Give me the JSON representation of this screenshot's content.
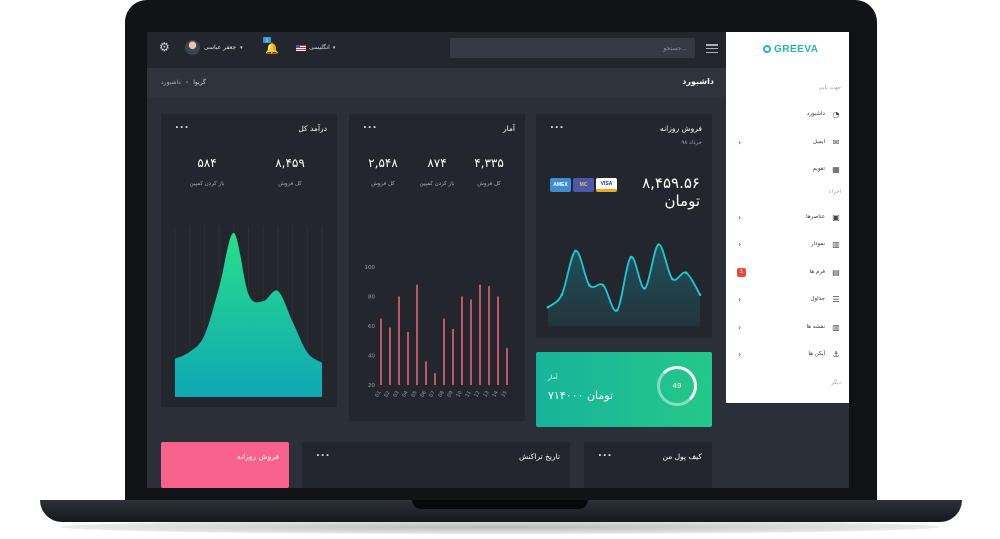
{
  "brand": {
    "logo_text": "GREEVA"
  },
  "topbar": {
    "search_placeholder": "جستجو...",
    "language": "انگلیسی",
    "notifications_count": "1",
    "user_name": "جعفر عباسی"
  },
  "header": {
    "page_title": "داشبورد",
    "breadcrumb": [
      "گریوا",
      "›",
      "داشبورد"
    ]
  },
  "sidebar": {
    "section_nav": "جهت یابی",
    "section_components": "اجزاء",
    "section_other": "دیگر",
    "items": [
      {
        "label": "داشبورد",
        "icon": "speedometer-icon"
      },
      {
        "label": "ایمیل",
        "icon": "envelope-icon"
      },
      {
        "label": "تقویم",
        "icon": "calendar-icon"
      },
      {
        "label": "عناصرها",
        "icon": "briefcase-icon"
      },
      {
        "label": "نمودار",
        "icon": "bar-chart-icon"
      },
      {
        "label": "فرم ها",
        "icon": "document-icon",
        "badge": "1"
      },
      {
        "label": "جداول",
        "icon": "list-icon"
      },
      {
        "label": "نقشه ها",
        "icon": "map-icon"
      },
      {
        "label": "آیکن ها",
        "icon": "anchor-icon"
      }
    ]
  },
  "cards": {
    "total_income": {
      "title": "درآمد کل",
      "stats": [
        {
          "value": "۸,۴۵۹",
          "label": "کل فروش"
        },
        {
          "value": "۵۸۴",
          "label": "باز کردن کمپین"
        }
      ]
    },
    "stats": {
      "title": "آمار",
      "stats": [
        {
          "value": "۴,۳۳۵",
          "label": "کل فروش"
        },
        {
          "value": "۸۷۴",
          "label": "باز کردن کمپین"
        },
        {
          "value": "۲,۵۴۸",
          "label": "کل فروش"
        }
      ]
    },
    "daily_sales": {
      "title": "فروش روزانه",
      "subtitle": "خرداد ۹۸",
      "amount_number": "۸,۴۵۹.۵۶",
      "amount_unit": "تومان",
      "payment_methods": [
        "AMEX",
        "MC",
        "VISA"
      ]
    },
    "green": {
      "label": "آمار",
      "amount": "۷۱۴۰۰۰ تومان",
      "progress_value": "49"
    },
    "bottom": {
      "daily_sales": "فروش روزانه",
      "transactions": "تاریخ تراکنش",
      "wallet": "کیف پول من"
    },
    "menu_dots": "..."
  },
  "chart_data": [
    {
      "type": "area",
      "title": "درآمد کل",
      "x": [
        0,
        1,
        2,
        3,
        4,
        5,
        6,
        7,
        8,
        9,
        10
      ],
      "values": [
        0.56,
        0.66,
        0.9,
        1.6,
        2.4,
        1.5,
        1.4,
        1.55,
        1.1,
        0.65,
        0.5
      ],
      "ylim": [
        0,
        2.5
      ],
      "grid": false
    },
    {
      "type": "bar",
      "title": "آمار",
      "categories": [
        "01",
        "02",
        "03",
        "04",
        "05",
        "06",
        "07",
        "08",
        "09",
        "10",
        "11",
        "12",
        "13",
        "14",
        "15"
      ],
      "values": [
        65,
        59,
        80,
        56,
        88,
        36,
        28,
        65,
        58,
        80,
        78,
        88,
        87,
        80,
        45
      ],
      "ylim": [
        20,
        100
      ],
      "yticks": [
        20,
        40,
        60,
        80,
        100
      ],
      "grid": true
    },
    {
      "type": "line",
      "title": "فروش روزانه",
      "x": [
        0,
        1,
        2,
        3,
        4,
        5,
        6,
        7,
        8,
        9,
        10,
        11
      ],
      "values": [
        0.6,
        1.0,
        2.4,
        1.3,
        1.3,
        0.5,
        2.2,
        1.2,
        2.6,
        1.5,
        1.7,
        1.0
      ],
      "ylim": [
        0,
        3
      ],
      "grid": false
    }
  ]
}
